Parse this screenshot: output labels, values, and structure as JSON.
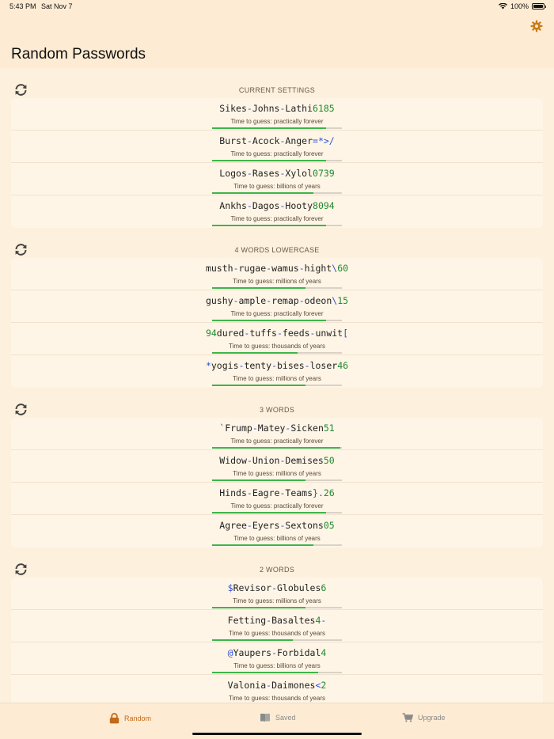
{
  "status_bar": {
    "time": "5:43 PM",
    "date": "Sat Nov 7",
    "battery": "100%"
  },
  "header": {
    "title": "Random Passwords",
    "settings_icon": "gear-icon"
  },
  "colors": {
    "accent": "#c97a1a",
    "digit": "#1e8a2e",
    "symbol": "#2b4fd8",
    "strength_bar": "#3cb54a"
  },
  "sections": [
    {
      "title": "CURRENT SETTINGS",
      "passwords": [
        {
          "segments": [
            [
              "w",
              "Sikes"
            ],
            [
              "s",
              "-"
            ],
            [
              "w",
              "Johns"
            ],
            [
              "s",
              "-"
            ],
            [
              "w",
              "Lathi"
            ],
            [
              "d",
              "6185"
            ]
          ],
          "guess": "Time to guess: practically forever",
          "strength": 0.88
        },
        {
          "segments": [
            [
              "w",
              "Burst"
            ],
            [
              "s",
              "-"
            ],
            [
              "w",
              "Acock"
            ],
            [
              "s",
              "-"
            ],
            [
              "w",
              "Anger"
            ],
            [
              "s",
              "=*>/"
            ]
          ],
          "guess": "Time to guess: practically forever",
          "strength": 0.88
        },
        {
          "segments": [
            [
              "w",
              "Logos"
            ],
            [
              "s",
              "-"
            ],
            [
              "w",
              "Rases"
            ],
            [
              "s",
              "-"
            ],
            [
              "w",
              "Xylol"
            ],
            [
              "d",
              "0739"
            ]
          ],
          "guess": "Time to guess: billions of years",
          "strength": 0.78
        },
        {
          "segments": [
            [
              "w",
              "Ankhs"
            ],
            [
              "s",
              "-"
            ],
            [
              "w",
              "Dagos"
            ],
            [
              "s",
              "-"
            ],
            [
              "w",
              "Hooty"
            ],
            [
              "d",
              "8094"
            ]
          ],
          "guess": "Time to guess: practically forever",
          "strength": 0.88
        }
      ]
    },
    {
      "title": "4 WORDS LOWERCASE",
      "passwords": [
        {
          "segments": [
            [
              "w",
              "musth"
            ],
            [
              "s",
              "-"
            ],
            [
              "w",
              "rugae"
            ],
            [
              "s",
              "-"
            ],
            [
              "w",
              "wamus"
            ],
            [
              "s",
              "-"
            ],
            [
              "w",
              "hight"
            ],
            [
              "s",
              "\\"
            ],
            [
              "d",
              "60"
            ]
          ],
          "guess": "Time to guess: millions of years",
          "strength": 0.72
        },
        {
          "segments": [
            [
              "w",
              "gushy"
            ],
            [
              "s",
              "-"
            ],
            [
              "w",
              "ample"
            ],
            [
              "s",
              "-"
            ],
            [
              "w",
              "remap"
            ],
            [
              "s",
              "-"
            ],
            [
              "w",
              "odeon"
            ],
            [
              "s",
              "\\"
            ],
            [
              "d",
              "15"
            ]
          ],
          "guess": "Time to guess: practically forever",
          "strength": 0.88
        },
        {
          "segments": [
            [
              "d",
              "94"
            ],
            [
              "w",
              "dured"
            ],
            [
              "s",
              "-"
            ],
            [
              "w",
              "tuffs"
            ],
            [
              "s",
              "-"
            ],
            [
              "w",
              "feeds"
            ],
            [
              "s",
              "-"
            ],
            [
              "w",
              "unwit"
            ],
            [
              "s",
              "["
            ]
          ],
          "guess": "Time to guess: thousands of years",
          "strength": 0.66
        },
        {
          "segments": [
            [
              "s",
              "*"
            ],
            [
              "w",
              "yogis"
            ],
            [
              "s",
              "-"
            ],
            [
              "w",
              "tenty"
            ],
            [
              "s",
              "-"
            ],
            [
              "w",
              "bises"
            ],
            [
              "s",
              "-"
            ],
            [
              "w",
              "loser"
            ],
            [
              "d",
              "46"
            ]
          ],
          "guess": "Time to guess: millions of years",
          "strength": 0.72
        }
      ]
    },
    {
      "title": "3 WORDS",
      "passwords": [
        {
          "segments": [
            [
              "s",
              "`"
            ],
            [
              "w",
              "Frump"
            ],
            [
              "s",
              "-"
            ],
            [
              "w",
              "Matey"
            ],
            [
              "s",
              "-"
            ],
            [
              "w",
              "Sicken"
            ],
            [
              "d",
              "51"
            ]
          ],
          "guess": "Time to guess: practically forever",
          "strength": 0.99
        },
        {
          "segments": [
            [
              "w",
              "Widow"
            ],
            [
              "s",
              "-"
            ],
            [
              "w",
              "Union"
            ],
            [
              "s",
              "-"
            ],
            [
              "w",
              "Demises"
            ],
            [
              "d",
              "50"
            ]
          ],
          "guess": "Time to guess: millions of years",
          "strength": 0.72
        },
        {
          "segments": [
            [
              "w",
              "Hinds"
            ],
            [
              "s",
              "-"
            ],
            [
              "w",
              "Eagre"
            ],
            [
              "s",
              "-"
            ],
            [
              "w",
              "Teams"
            ],
            [
              "s",
              "}."
            ],
            [
              "d",
              "26"
            ]
          ],
          "guess": "Time to guess: practically forever",
          "strength": 0.88
        },
        {
          "segments": [
            [
              "w",
              "Agree"
            ],
            [
              "s",
              "-"
            ],
            [
              "w",
              "Eyers"
            ],
            [
              "s",
              "-"
            ],
            [
              "w",
              "Sextons"
            ],
            [
              "d",
              "05"
            ]
          ],
          "guess": "Time to guess: billions of years",
          "strength": 0.78
        }
      ]
    },
    {
      "title": "2 WORDS",
      "passwords": [
        {
          "segments": [
            [
              "s",
              "$"
            ],
            [
              "w",
              "Revisor"
            ],
            [
              "s",
              "-"
            ],
            [
              "w",
              "Globules"
            ],
            [
              "d",
              "6"
            ]
          ],
          "guess": "Time to guess: millions of years",
          "strength": 0.72
        },
        {
          "segments": [
            [
              "w",
              "Fetting"
            ],
            [
              "s",
              "-"
            ],
            [
              "w",
              "Basaltes"
            ],
            [
              "d",
              "4"
            ],
            [
              "s",
              "-"
            ]
          ],
          "guess": "Time to guess: thousands of years",
          "strength": 0.62
        },
        {
          "segments": [
            [
              "s",
              "@"
            ],
            [
              "w",
              "Yaupers"
            ],
            [
              "s",
              "-"
            ],
            [
              "w",
              "Forbidal"
            ],
            [
              "d",
              "4"
            ]
          ],
          "guess": "Time to guess: billions of years",
          "strength": 0.82
        },
        {
          "segments": [
            [
              "w",
              "Valonia"
            ],
            [
              "s",
              "-"
            ],
            [
              "w",
              "Daimones"
            ],
            [
              "s",
              "<"
            ],
            [
              "d",
              "2"
            ]
          ],
          "guess": "Time to guess: thousands of years",
          "strength": 0.66
        }
      ]
    }
  ],
  "tabs": [
    {
      "label": "Random",
      "icon": "lock-icon",
      "active": true
    },
    {
      "label": "Saved",
      "icon": "book-icon",
      "active": false
    },
    {
      "label": "Upgrade",
      "icon": "cart-icon",
      "active": false
    }
  ]
}
